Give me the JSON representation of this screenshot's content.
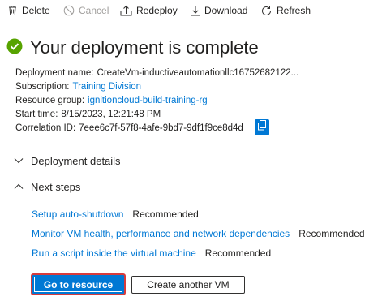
{
  "toolbar": {
    "delete_label": "Delete",
    "cancel_label": "Cancel",
    "redeploy_label": "Redeploy",
    "download_label": "Download",
    "refresh_label": "Refresh"
  },
  "header": {
    "title": "Your deployment is complete",
    "status_icon": "success-check-icon",
    "status_color": "#57a300"
  },
  "details": {
    "deployment_name_label": "Deployment name:",
    "deployment_name": "CreateVm-inductiveautomationllc16752682122...",
    "subscription_label": "Subscription:",
    "subscription": "Training Division",
    "resource_group_label": "Resource group:",
    "resource_group": "ignitioncloud-build-training-rg",
    "start_time_label": "Start time:",
    "start_time": "8/15/2023, 12:21:48 PM",
    "correlation_id_label": "Correlation ID:",
    "correlation_id": "7eee6c7f-57f8-4afe-9bd7-9df1f9ce8d4d"
  },
  "sections": {
    "deployment_details": "Deployment details",
    "next_steps": "Next steps"
  },
  "next_steps": [
    {
      "link": "Setup auto-shutdown",
      "tag": "Recommended"
    },
    {
      "link": "Monitor VM health, performance and network dependencies",
      "tag": "Recommended"
    },
    {
      "link": "Run a script inside the virtual machine",
      "tag": "Recommended"
    }
  ],
  "actions": {
    "primary": "Go to resource",
    "secondary": "Create another VM"
  },
  "colors": {
    "accent": "#0078d4",
    "highlight": "#d83b3b",
    "disabled": "#a19f9d"
  }
}
